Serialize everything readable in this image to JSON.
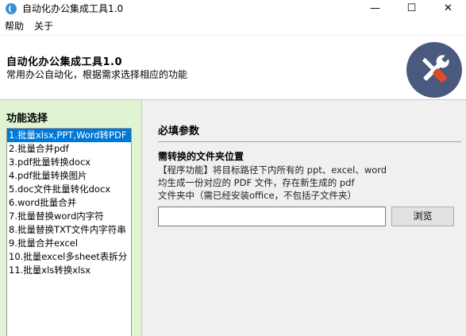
{
  "window": {
    "title": "自动化办公集成工具1.0",
    "minimize_glyph": "—",
    "maximize_glyph": "☐",
    "close_glyph": "✕"
  },
  "menu": [
    "帮助",
    "关于"
  ],
  "header": {
    "title": "自动化办公集成工具1.0",
    "subtitle": "常用办公自动化，根据需求选择相应的功能",
    "logo_icon": "tools-icon",
    "logo_color": "#4a5a7f"
  },
  "sidebar": {
    "title": "功能选择",
    "selected_index": 0,
    "items": [
      "1.批量xlsx,PPT,Word转PDF",
      "2.批量合并pdf",
      "3.pdf批量转换docx",
      "4.pdf批量转换图片",
      "5.doc文件批量转化docx",
      "6.word批量合并",
      "7.批量替换word内字符",
      "8.批量替换TXT文件内字符串",
      "9.批量合并excel",
      "10.批量excel多sheet表拆分",
      "11.批量xls转换xlsx"
    ],
    "background": "#e0f4d4",
    "selection_color": "#0078d7"
  },
  "main": {
    "section_title": "必填参数",
    "field_label": "需转换的文件夹位置",
    "help_lines": [
      "【程序功能】将目标路径下内所有的 ppt、excel、word",
      "均生成一份对应的 PDF 文件，存在新生成的 pdf",
      "文件夹中（需已经安装office，不包括子文件夹）"
    ],
    "path_value": "",
    "browse_label": "浏览"
  }
}
